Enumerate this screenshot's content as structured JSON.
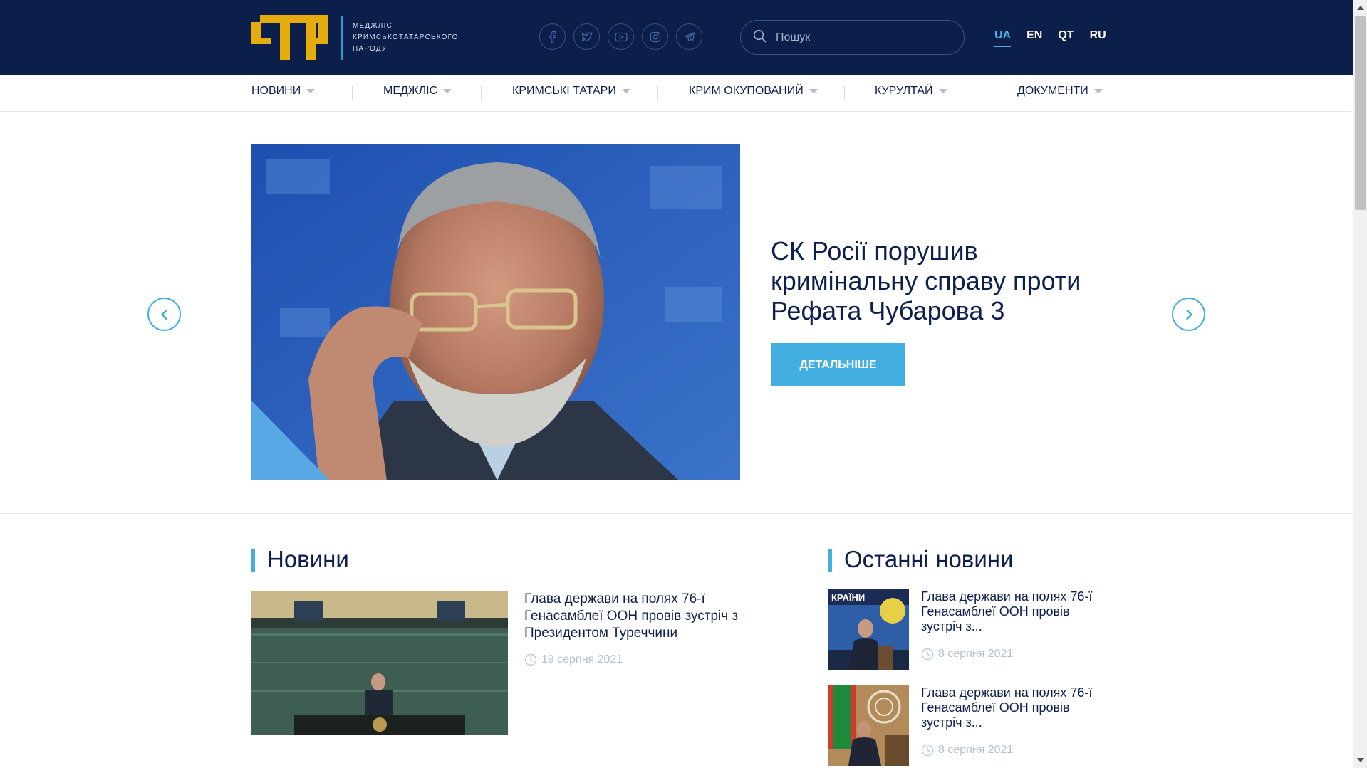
{
  "header": {
    "logo_text": "МЕДЖЛІС КРИМСЬКОТАТАРСЬКОГО НАРОДУ",
    "brand_color": "#0c1f4b",
    "accent_color": "#43aee0",
    "logo_color": "#e5ac0e",
    "socials": [
      {
        "icon": "facebook-icon"
      },
      {
        "icon": "twitter-icon"
      },
      {
        "icon": "youtube-icon"
      },
      {
        "icon": "instagram-icon"
      },
      {
        "icon": "telegram-icon"
      }
    ],
    "search": {
      "placeholder": "Пошук"
    },
    "languages": [
      {
        "code": "UA",
        "active": true
      },
      {
        "code": "EN",
        "active": false
      },
      {
        "code": "QT",
        "active": false
      },
      {
        "code": "RU",
        "active": false
      }
    ]
  },
  "nav": {
    "items": [
      {
        "label": "НОВИНИ"
      },
      {
        "label": "МЕДЖЛІС"
      },
      {
        "label": "КРИМСЬКІ ТАТАРИ"
      },
      {
        "label": "КРИМ ОКУПОВАНИЙ"
      },
      {
        "label": "КУРУЛТАЙ"
      },
      {
        "label": "ДОКУМЕНТИ"
      }
    ]
  },
  "hero": {
    "title": "СК Росії порушив кримінальну справу проти Рефата Чубарова 3",
    "button_label": "ДЕТАЛЬНІШЕ"
  },
  "news": {
    "section_title": "Новини",
    "featured": {
      "title": "Глава держави на полях 76-ї Генасамблеї ООН провів зустріч з Президентом Туреччини",
      "date": "19 серпня 2021"
    }
  },
  "latest": {
    "section_title": "Останні новини",
    "items": [
      {
        "title": "Глава держави на полях 76-ї Генасамблеї ООН провів зустріч з...",
        "date": "8 серпня 2021"
      },
      {
        "title": "Глава держави на полях 76-ї Генасамблеї ООН провів зустріч з...",
        "date": "8 серпня 2021"
      }
    ]
  }
}
